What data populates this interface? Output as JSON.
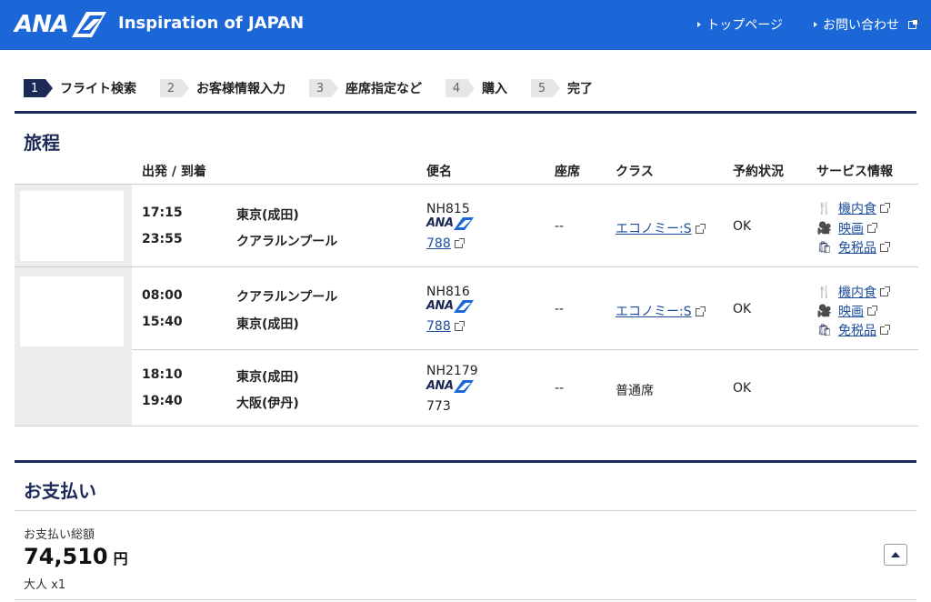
{
  "header": {
    "logo": "ANA",
    "tagline": "Inspiration of JAPAN",
    "links": [
      {
        "label": "トップページ"
      },
      {
        "label": "お問い合わせ"
      }
    ]
  },
  "steps": [
    {
      "num": "1",
      "label": "フライト検索",
      "active": true
    },
    {
      "num": "2",
      "label": "お客様情報入力",
      "active": false
    },
    {
      "num": "3",
      "label": "座席指定など",
      "active": false
    },
    {
      "num": "4",
      "label": "購入",
      "active": false
    },
    {
      "num": "5",
      "label": "完了",
      "active": false
    }
  ],
  "itinerary": {
    "title": "旅程",
    "columns": {
      "dep_arr": "出発 / 到着",
      "flight": "便名",
      "seat": "座席",
      "class": "クラス",
      "status": "予約状況",
      "service": "サービス情報"
    },
    "flights": [
      {
        "dep_time": "17:15",
        "dep_city": "東京(成田)",
        "arr_time": "23:55",
        "arr_city": "クアラルンプール",
        "flight_no": "NH815",
        "airline_logo": "ANA",
        "aircraft": "788",
        "seat": "--",
        "class": "エコノミー:S",
        "status": "OK",
        "services": [
          "機内食",
          "映画",
          "免税品"
        ]
      },
      {
        "dep_time": "08:00",
        "dep_city": "クアラルンプール",
        "arr_time": "15:40",
        "arr_city": "東京(成田)",
        "flight_no": "NH816",
        "airline_logo": "ANA",
        "aircraft": "788",
        "seat": "--",
        "class": "エコノミー:S",
        "status": "OK",
        "services": [
          "機内食",
          "映画",
          "免税品"
        ]
      },
      {
        "dep_time": "18:10",
        "dep_city": "東京(成田)",
        "arr_time": "19:40",
        "arr_city": "大阪(伊丹)",
        "flight_no": "NH2179",
        "airline_logo": "ANA",
        "aircraft": "773",
        "seat": "--",
        "class": "普通席",
        "status": "OK",
        "services": []
      }
    ]
  },
  "payment": {
    "title": "お支払い",
    "total_label": "お支払い総額",
    "amount": "74,510",
    "currency": "円",
    "passengers": "大人 x1"
  },
  "colors": {
    "brand_blue": "#1b67d8",
    "navy": "#1d2a55",
    "link": "#1d4e9c"
  }
}
